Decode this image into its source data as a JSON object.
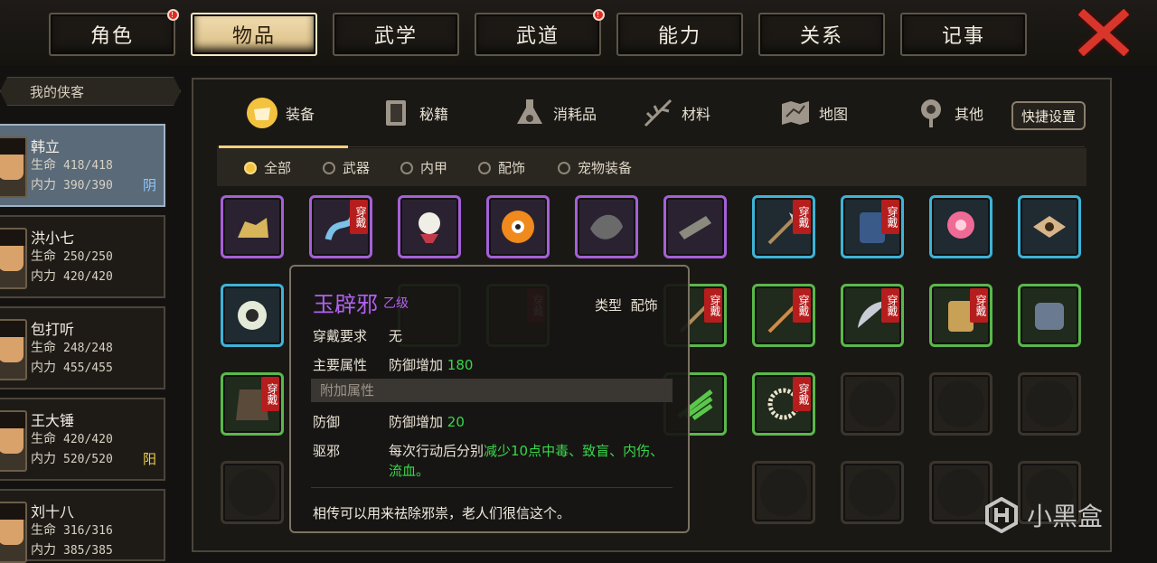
{
  "tabs": [
    {
      "label": "角色",
      "badge": "!"
    },
    {
      "label": "物品",
      "active": true
    },
    {
      "label": "武学"
    },
    {
      "label": "武道",
      "badge": "!"
    },
    {
      "label": "能力"
    },
    {
      "label": "关系"
    },
    {
      "label": "记事"
    }
  ],
  "sidebar": {
    "header": "我的侠客",
    "heroes": [
      {
        "name": "韩立",
        "hp_label": "生命",
        "hp": "418/418",
        "mp_label": "内力",
        "mp": "390/390",
        "badge": "阴"
      },
      {
        "name": "洪小七",
        "hp_label": "生命",
        "hp": "250/250",
        "mp_label": "内力",
        "mp": "420/420",
        "badge": ""
      },
      {
        "name": "包打听",
        "hp_label": "生命",
        "hp": "248/248",
        "mp_label": "内力",
        "mp": "455/455",
        "badge": ""
      },
      {
        "name": "王大锤",
        "hp_label": "生命",
        "hp": "420/420",
        "mp_label": "内力",
        "mp": "520/520",
        "badge": "阳"
      },
      {
        "name": "刘十八",
        "hp_label": "生命",
        "hp": "316/316",
        "mp_label": "内力",
        "mp": "385/385",
        "badge": ""
      }
    ]
  },
  "categories": [
    {
      "label": "装备",
      "icon": "equipment-icon"
    },
    {
      "label": "秘籍",
      "icon": "book-icon"
    },
    {
      "label": "消耗品",
      "icon": "potion-icon"
    },
    {
      "label": "材料",
      "icon": "herb-icon"
    },
    {
      "label": "地图",
      "icon": "map-icon"
    },
    {
      "label": "其他",
      "icon": "misc-icon"
    }
  ],
  "hotkey_button": "快捷设置",
  "filters": [
    {
      "label": "全部",
      "selected": true
    },
    {
      "label": "武器"
    },
    {
      "label": "内甲"
    },
    {
      "label": "配饰"
    },
    {
      "label": "宠物装备"
    }
  ],
  "wear_label": "穿戴",
  "tooltip": {
    "name": "玉辟邪",
    "grade": "乙级",
    "type_label": "类型",
    "type_value": "配饰",
    "req_label": "穿戴要求",
    "req_value": "无",
    "main_label": "主要属性",
    "main_value_prefix": "防御增加",
    "main_value_num": "180",
    "extra_header": "附加属性",
    "def_label": "防御",
    "def_value_prefix": "防御增加",
    "def_value_num": "20",
    "exorcise_label": "驱邪",
    "exorcise_text_a": "每次行动后分别",
    "exorcise_text_b": "减少10点中毒、致盲、内伤、",
    "exorcise_text_c": "流血。",
    "description": "相传可以用来祛除邪祟，老人们很信这个。"
  },
  "watermark": "小黑盒",
  "colors": {
    "purple": "#a560d8",
    "blue": "#3db3d8",
    "green": "#5ab84a",
    "gold": "#f3cf7c",
    "wear_red": "#b61d1d"
  }
}
